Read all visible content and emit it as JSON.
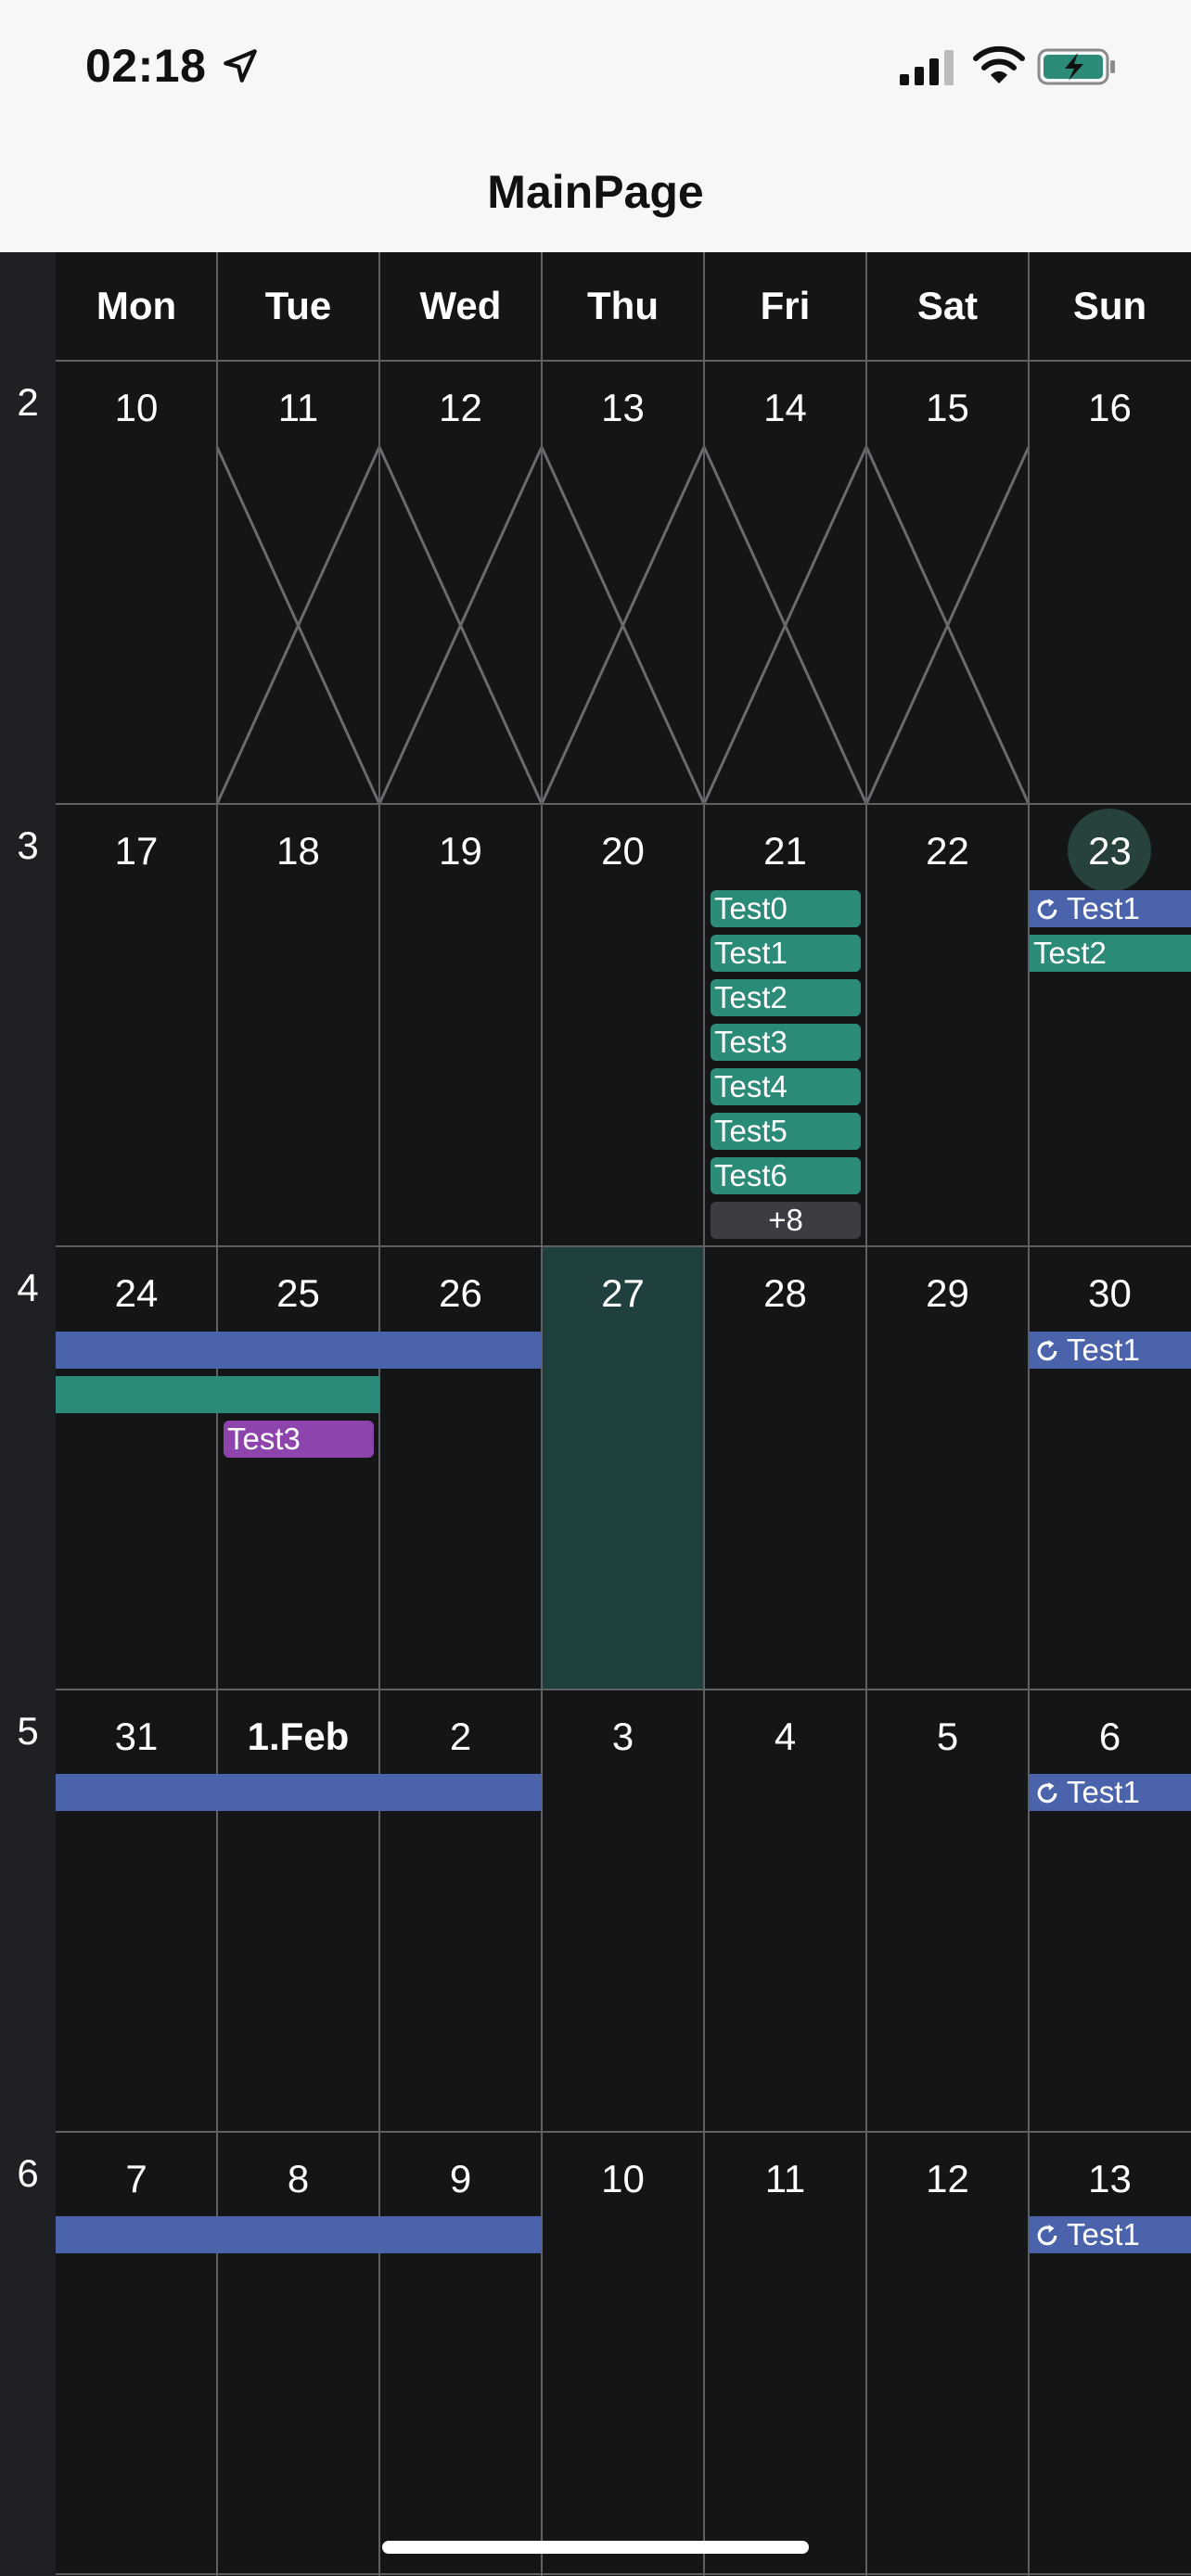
{
  "status_bar": {
    "time": "02:18"
  },
  "nav": {
    "title": "MainPage"
  },
  "calendar": {
    "day_headers": [
      "Mon",
      "Tue",
      "Wed",
      "Thu",
      "Fri",
      "Sat",
      "Sun"
    ],
    "weeks": [
      {
        "number": "2",
        "dates": [
          "10",
          "11",
          "12",
          "13",
          "14",
          "15",
          "16"
        ]
      },
      {
        "number": "3",
        "dates": [
          "17",
          "18",
          "19",
          "20",
          "21",
          "22",
          "23"
        ]
      },
      {
        "number": "4",
        "dates": [
          "24",
          "25",
          "26",
          "27",
          "28",
          "29",
          "30"
        ]
      },
      {
        "number": "5",
        "dates": [
          "31",
          "1.Feb",
          "2",
          "3",
          "4",
          "5",
          "6"
        ]
      },
      {
        "number": "6",
        "dates": [
          "7",
          "8",
          "9",
          "10",
          "11",
          "12",
          "13"
        ]
      }
    ],
    "today": "23",
    "selected_date": "27",
    "events": {
      "fri21": [
        "Test0",
        "Test1",
        "Test2",
        "Test3",
        "Test4",
        "Test5",
        "Test6"
      ],
      "fri21_more": "+8",
      "sun23": [
        "Test1",
        "Test2"
      ],
      "recurring_label": "Test1",
      "tue25": "Test3"
    },
    "colors": {
      "green": "#2b8a78",
      "blue": "#4a63aa",
      "purple": "#8e44ad",
      "today": "#27413d",
      "selected": "#1f403e"
    }
  }
}
